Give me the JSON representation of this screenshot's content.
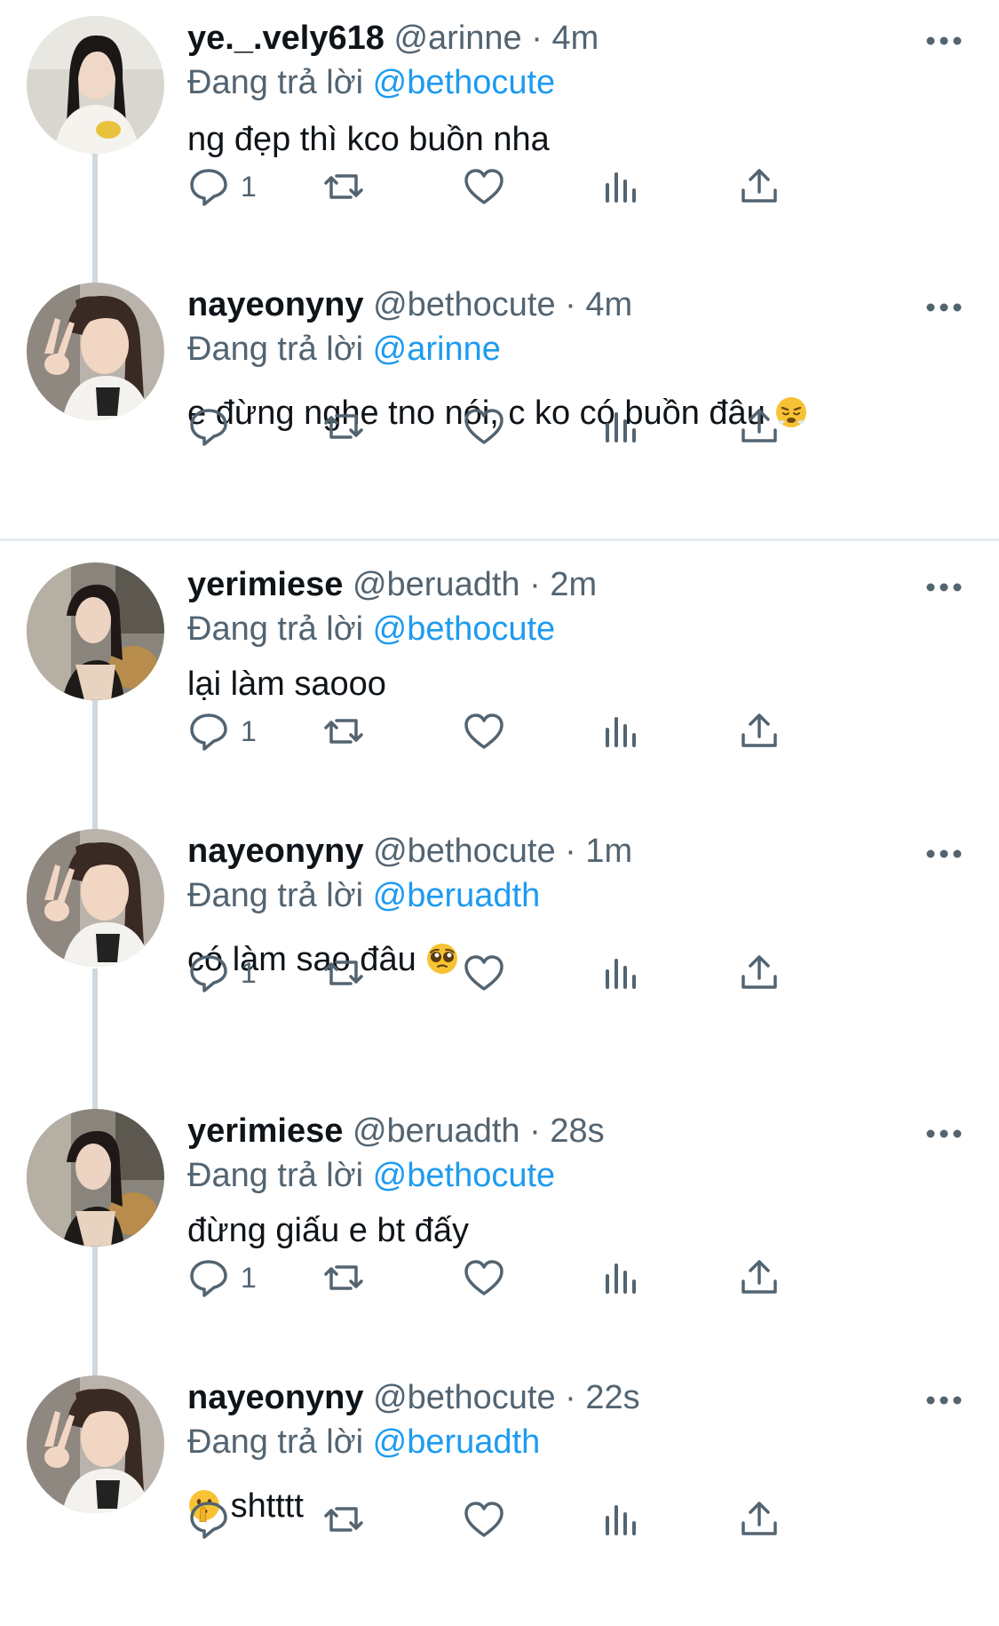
{
  "reply_prefix": "Đang trả lời",
  "tweets": [
    {
      "display_name": "ye._.vely618",
      "handle": "@arinne",
      "dot": "·",
      "time": "4m",
      "reply_to": "@bethocute",
      "text": "ng đẹp thì kco buồn nha",
      "emoji": "",
      "reply_count": "1"
    },
    {
      "display_name": "nayeonyny",
      "handle": "@bethocute",
      "dot": "·",
      "time": "4m",
      "reply_to": "@arinne",
      "text": "e đừng nghe tno nói, c ko có buồn đâu",
      "emoji": "huffing-face-emoji",
      "reply_count": ""
    },
    {
      "display_name": "yerimiese",
      "handle": "@beruadth",
      "dot": "·",
      "time": "2m",
      "reply_to": "@bethocute",
      "text": "lại làm saooo",
      "emoji": "",
      "reply_count": "1"
    },
    {
      "display_name": "nayeonyny",
      "handle": "@bethocute",
      "dot": "·",
      "time": "1m",
      "reply_to": "@beruadth",
      "text": "có làm sao đâu",
      "emoji": "pleading-face-emoji",
      "reply_count": "1"
    },
    {
      "display_name": "yerimiese",
      "handle": "@beruadth",
      "dot": "·",
      "time": "28s",
      "reply_to": "@bethocute",
      "text": "đừng giấu e bt đấy",
      "emoji": "",
      "reply_count": "1"
    },
    {
      "display_name": "nayeonyny",
      "handle": "@bethocute",
      "dot": "·",
      "time": "22s",
      "reply_to": "@beruadth",
      "text": "shtttt",
      "emoji": "shushing-face-emoji",
      "reply_count": ""
    }
  ],
  "colors": {
    "accent": "#1d9bf0",
    "secondary_text": "#536471",
    "thread_line": "#cfd9de",
    "icon": "#536471"
  }
}
